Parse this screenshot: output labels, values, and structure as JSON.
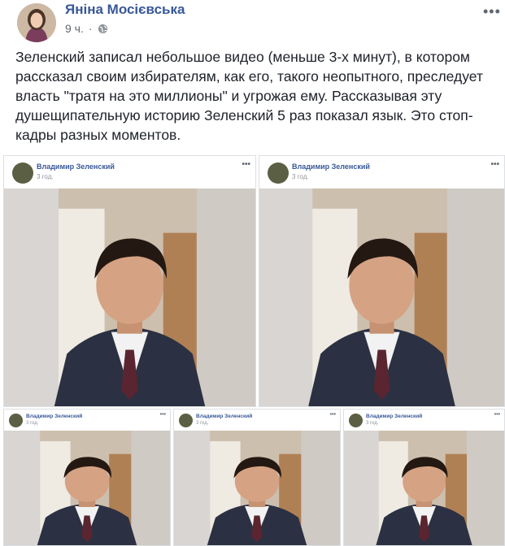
{
  "post": {
    "author": "Яніна Мосієвська",
    "time": "9 ч.",
    "text": "Зеленский записал небольшое видео (меньше 3-х минут), в котором рассказал своим избирателям, как его, такого неопытного, преследует власть \"тратя на это миллионы\" и угрожая ему. Рассказывая эту душещипательную историю Зеленский 5 раз показал язык. Это стоп-кадры разных моментов."
  },
  "frames": [
    {
      "name": "Владимир Зеленский",
      "time": "3 год."
    },
    {
      "name": "Владимир Зеленский",
      "time": "3 год."
    },
    {
      "name": "Владимир Зеленский",
      "time": "3 год."
    },
    {
      "name": "Владимир Зеленский",
      "time": "3 год."
    },
    {
      "name": "Владимир Зеленский",
      "time": "3 год."
    }
  ],
  "icons": {
    "privacy": "globe-icon",
    "more": "more-options-icon"
  },
  "colors": {
    "link": "#385898",
    "meta": "#606770",
    "text": "#1d2129",
    "border": "#dddfe2"
  }
}
